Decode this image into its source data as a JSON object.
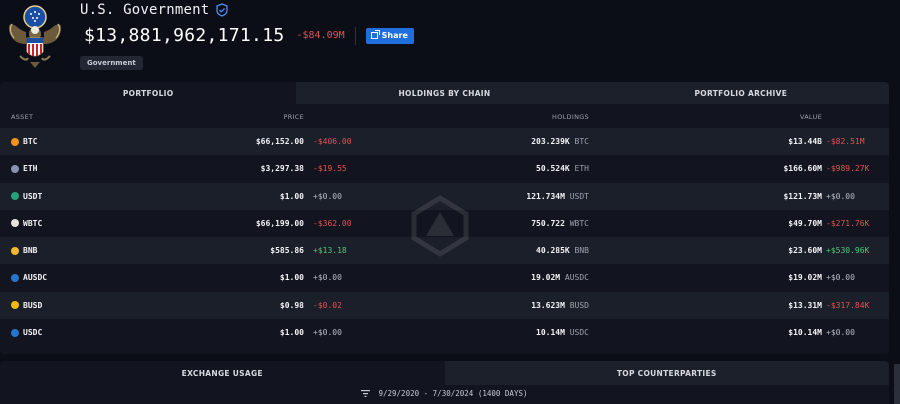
{
  "header": {
    "entity_name": "U.S. Government",
    "total_value": "$13,881,962,171.15",
    "change": "-$84.09M",
    "share_label": "Share",
    "tag": "Government"
  },
  "tabs": [
    {
      "label": "PORTFOLIO",
      "active": true
    },
    {
      "label": "HOLDINGS BY CHAIN",
      "active": false
    },
    {
      "label": "PORTFOLIO ARCHIVE",
      "active": false
    }
  ],
  "table": {
    "columns": {
      "asset": "ASSET",
      "price": "PRICE",
      "holdings": "HOLDINGS",
      "value": "VALUE"
    },
    "rows": [
      {
        "symbol": "BTC",
        "coin_color": "#f7931a",
        "price": "$66,152.00",
        "price_change": "-$406.00",
        "price_dir": "neg",
        "holdings": "203.239K",
        "unit": "BTC",
        "value": "$13.44B",
        "value_change": "-$82.51M",
        "value_dir": "neg"
      },
      {
        "symbol": "ETH",
        "coin_color": "#8a92b2",
        "price": "$3,297.38",
        "price_change": "-$19.55",
        "price_dir": "neg",
        "holdings": "50.524K",
        "unit": "ETH",
        "value": "$166.60M",
        "value_change": "-$989.27K",
        "value_dir": "neg"
      },
      {
        "symbol": "USDT",
        "coin_color": "#26a17b",
        "price": "$1.00",
        "price_change": "+$0.00",
        "price_dir": "zero",
        "holdings": "121.734M",
        "unit": "USDT",
        "value": "$121.73M",
        "value_change": "+$0.00",
        "value_dir": "zero"
      },
      {
        "symbol": "WBTC",
        "coin_color": "#e6e2dc",
        "price": "$66,199.00",
        "price_change": "-$362.00",
        "price_dir": "neg",
        "holdings": "750.722",
        "unit": "WBTC",
        "value": "$49.70M",
        "value_change": "-$271.76K",
        "value_dir": "neg"
      },
      {
        "symbol": "BNB",
        "coin_color": "#f3ba2f",
        "price": "$585.86",
        "price_change": "+$13.18",
        "price_dir": "pos",
        "holdings": "40.285K",
        "unit": "BNB",
        "value": "$23.60M",
        "value_change": "+$530.96K",
        "value_dir": "pos"
      },
      {
        "symbol": "AUSDC",
        "coin_color": "#2775ca",
        "price": "$1.00",
        "price_change": "+$0.00",
        "price_dir": "zero",
        "holdings": "19.02M",
        "unit": "AUSDC",
        "value": "$19.02M",
        "value_change": "+$0.00",
        "value_dir": "zero"
      },
      {
        "symbol": "BUSD",
        "coin_color": "#f0b90b",
        "price": "$0.98",
        "price_change": "-$0.02",
        "price_dir": "neg",
        "holdings": "13.623M",
        "unit": "BUSD",
        "value": "$13.31M",
        "value_change": "-$317.84K",
        "value_dir": "neg"
      },
      {
        "symbol": "USDC",
        "coin_color": "#2775ca",
        "price": "$1.00",
        "price_change": "+$0.00",
        "price_dir": "zero",
        "holdings": "10.14M",
        "unit": "USDC",
        "value": "$10.14M",
        "value_change": "+$0.00",
        "value_dir": "zero"
      }
    ]
  },
  "bottom_tabs": [
    {
      "label": "EXCHANGE USAGE",
      "active": true
    },
    {
      "label": "TOP COUNTERPARTIES",
      "active": false
    }
  ],
  "date_range": "9/29/2020 - 7/30/2024 (1400 DAYS)",
  "icons": {
    "seal": "us-seal-icon",
    "verified": "verified-badge-icon",
    "share": "external-link-icon",
    "filter": "filter-icon",
    "watermark": "arkham-logo-icon"
  }
}
